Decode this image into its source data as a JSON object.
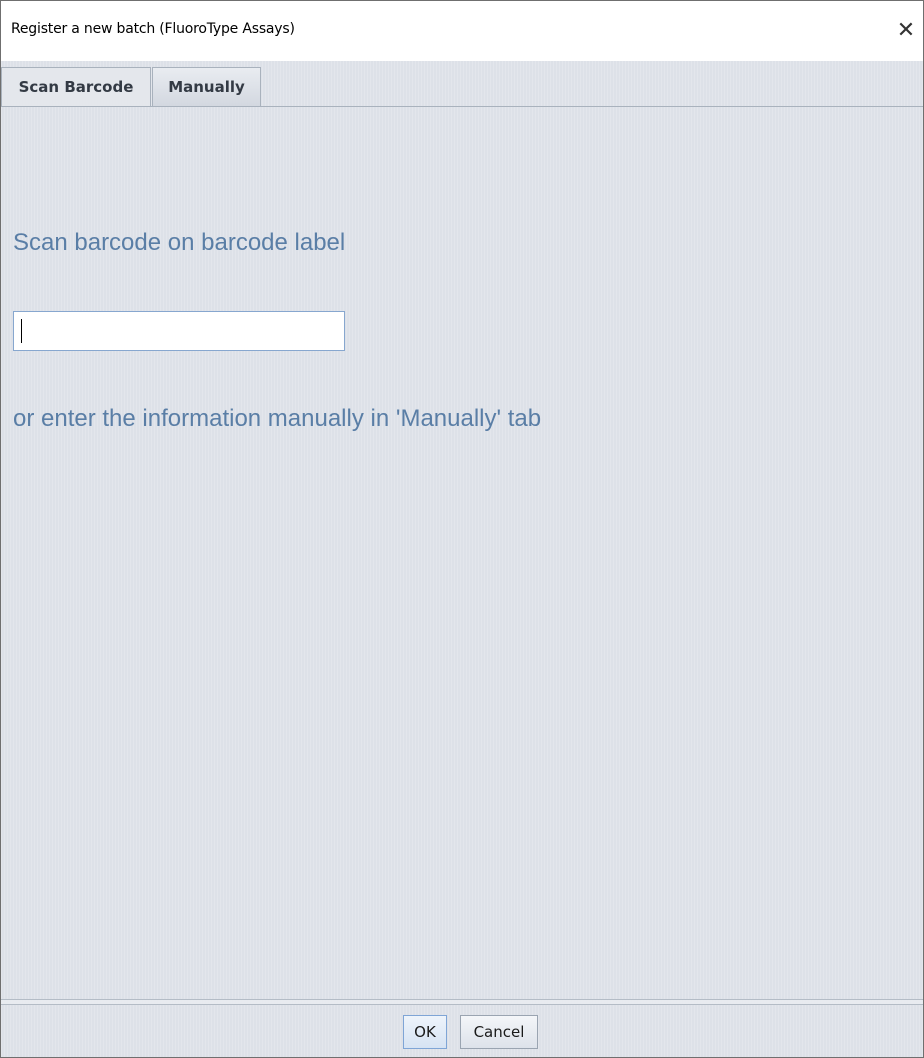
{
  "window": {
    "title": "Register a new batch (FluoroType Assays)",
    "close_glyph": "✕"
  },
  "tabs": [
    {
      "label": "Scan Barcode",
      "active": true
    },
    {
      "label": "Manually",
      "active": false
    }
  ],
  "scan_panel": {
    "instruction": "Scan barcode on barcode label",
    "barcode_value": "",
    "barcode_placeholder": "",
    "alternative": "or enter the information manually in 'Manually' tab"
  },
  "footer": {
    "ok_label": "OK",
    "cancel_label": "Cancel"
  },
  "colors": {
    "content_bg": "#dde1e8",
    "instruction_text": "#5a7ea6",
    "input_border": "#87a7cf"
  }
}
